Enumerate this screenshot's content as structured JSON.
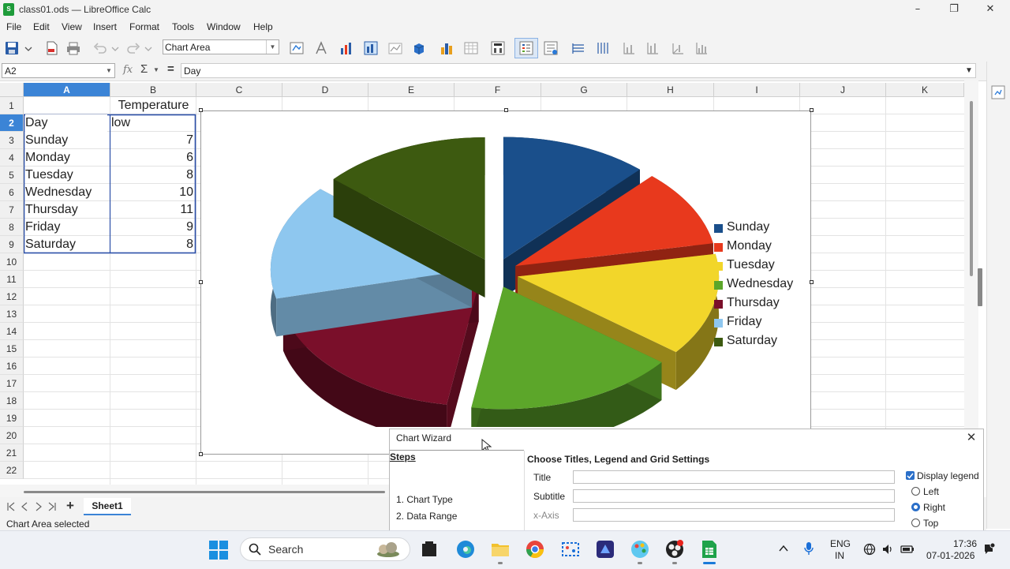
{
  "window": {
    "title": "class01.ods — LibreOffice Calc",
    "logo_letter": "S",
    "minimize": "–",
    "maximize": "❐",
    "close": "✕"
  },
  "menu": [
    "File",
    "Edit",
    "View",
    "Insert",
    "Format",
    "Tools",
    "Window",
    "Help"
  ],
  "toolbar": {
    "chart_element": "Chart Area"
  },
  "formula": {
    "cell_ref": "A2",
    "content": "Day",
    "fx_symbol": "fx",
    "sum_symbol": "Σ",
    "equals": "="
  },
  "columns": [
    "A",
    "B",
    "C",
    "D",
    "E",
    "F",
    "G",
    "H",
    "I",
    "J",
    "K"
  ],
  "rows": [
    "1",
    "2",
    "3",
    "4",
    "5",
    "6",
    "7",
    "8",
    "9",
    "10",
    "11",
    "12",
    "13",
    "14",
    "15",
    "16",
    "17",
    "18",
    "19",
    "20",
    "21",
    "22"
  ],
  "cells": {
    "b1": "Temperature",
    "a2": "Day",
    "b2": "low",
    "data": [
      {
        "day": "Sunday",
        "low": "7"
      },
      {
        "day": "Monday",
        "low": "6"
      },
      {
        "day": "Tuesday",
        "low": "8"
      },
      {
        "day": "Wednesday",
        "low": "10"
      },
      {
        "day": "Thursday",
        "low": "11"
      },
      {
        "day": "Friday",
        "low": "9"
      },
      {
        "day": "Saturday",
        "low": "8"
      }
    ]
  },
  "chart_data": {
    "type": "pie",
    "variant": "3d-exploded",
    "categories": [
      "Sunday",
      "Monday",
      "Tuesday",
      "Wednesday",
      "Thursday",
      "Friday",
      "Saturday"
    ],
    "values": [
      7,
      6,
      8,
      10,
      11,
      9,
      8
    ],
    "colors": [
      "#1a4f8b",
      "#e8391d",
      "#f2d62a",
      "#5ca62a",
      "#7a0f2a",
      "#8ec7ef",
      "#3d5a10"
    ],
    "legend": "right",
    "title": "",
    "xlabel": "",
    "ylabel": ""
  },
  "sheet": {
    "tab": "Sheet1",
    "add": "+"
  },
  "status": {
    "text": "Chart Area selected"
  },
  "wizard": {
    "title": "Chart Wizard",
    "close": "✕",
    "steps_heading": "Steps",
    "steps": [
      "1. Chart Type",
      "2. Data Range"
    ],
    "page_heading": "Choose Titles, Legend and Grid Settings",
    "fields": [
      "Title",
      "Subtitle",
      "x-Axis"
    ],
    "display_legend": "Display legend",
    "legend_positions": [
      "Left",
      "Right",
      "Top"
    ]
  },
  "taskbar": {
    "search": "Search",
    "lang_top": "ENG",
    "lang_bottom": "IN",
    "time": "17:36",
    "date": "07-01-2026"
  }
}
